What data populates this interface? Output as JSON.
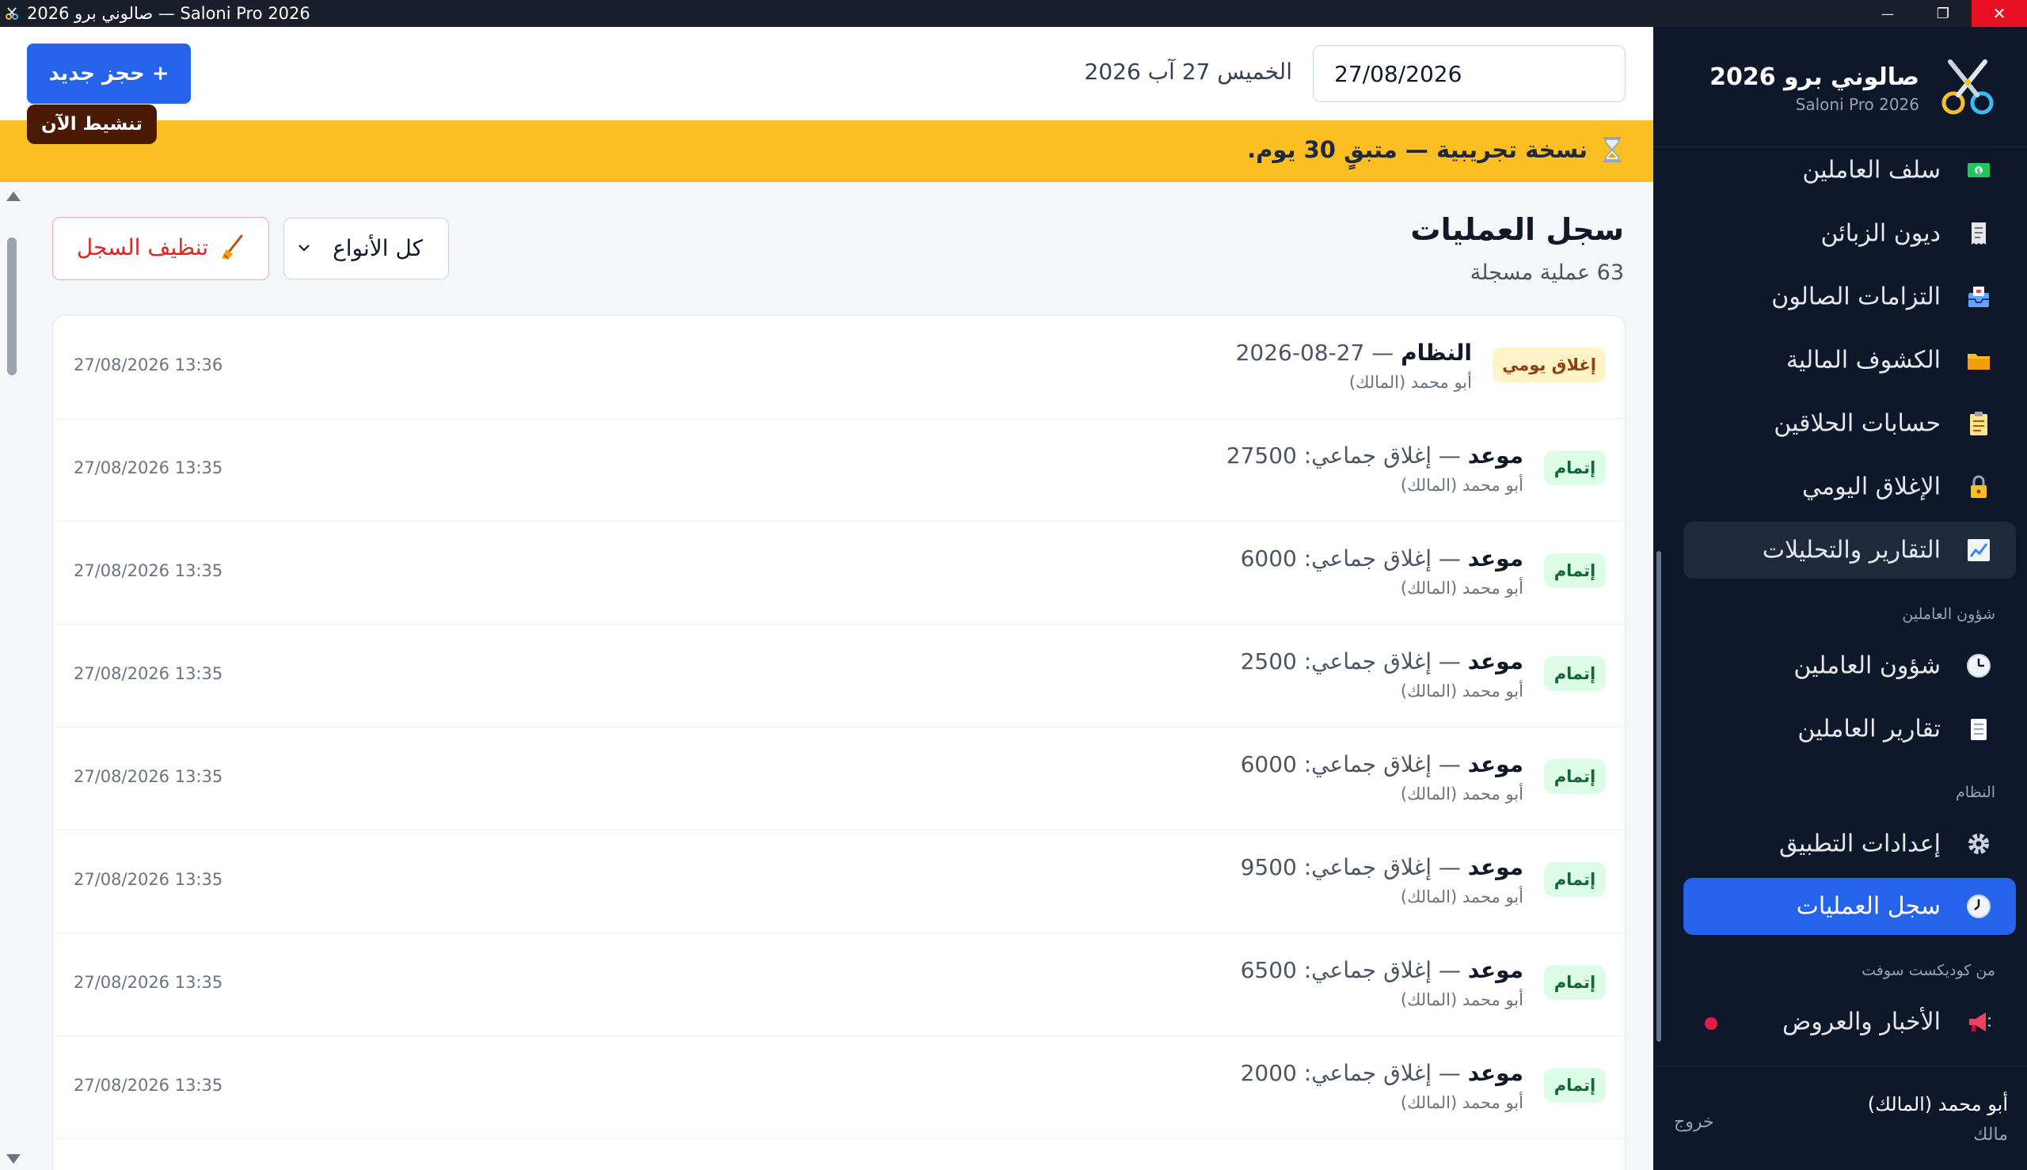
{
  "window": {
    "title": "صالوني برو 2026 — Saloni Pro 2026",
    "minimize": "—",
    "maximize": "❐",
    "close": "✕"
  },
  "brand": {
    "title": "صالوني برو 2026",
    "subtitle": "Saloni Pro 2026",
    "icon": "scissors-logo-icon"
  },
  "sidebar": {
    "items": [
      {
        "label": "سلف العاملين",
        "icon": "money-icon"
      },
      {
        "label": "ديون الزبائن",
        "icon": "receipt-icon"
      },
      {
        "label": "التزامات الصالون",
        "icon": "inbox-icon"
      },
      {
        "label": "الكشوف المالية",
        "icon": "folder-icon"
      },
      {
        "label": "حسابات الحلاقين",
        "icon": "clipboard-icon"
      },
      {
        "label": "الإغلاق اليومي",
        "icon": "lock-icon"
      },
      {
        "label": "التقارير والتحليلات",
        "icon": "chart-icon"
      }
    ],
    "section_staff": "شؤون العاملين",
    "staff_items": [
      {
        "label": "شؤون العاملين",
        "icon": "clock-icon"
      },
      {
        "label": "تقارير العاملين",
        "icon": "notepad-icon"
      }
    ],
    "section_system": "النظام",
    "system_items": [
      {
        "label": "إعدادات التطبيق",
        "icon": "gear-icon"
      },
      {
        "label": "سجل العمليات",
        "icon": "history-clock-icon"
      }
    ],
    "section_vendor": "من كوديكست سوفت",
    "vendor_items": [
      {
        "label": "الأخبار والعروض",
        "icon": "megaphone-icon"
      }
    ]
  },
  "user": {
    "name": "أبو محمد (المالك)",
    "role": "مالك",
    "logout": "خروج"
  },
  "topbar": {
    "new_booking": "+ حجز جديد",
    "date_label": "الخميس 27 آب 2026",
    "date_value": "27/08/2026"
  },
  "trial": {
    "text": "نسخة تجريبية — متبقٍ 30 يوم.",
    "activate": "تنشيط الآن",
    "icon": "hourglass-icon"
  },
  "page": {
    "title": "سجل العمليات",
    "count": "63 عملية مسجلة",
    "filter_value": "كل الأنواع",
    "clean_label": "تنظيف السجل",
    "clean_icon": "broom-icon"
  },
  "log": [
    {
      "badge": "إغلاق يومي",
      "kind": "close",
      "entity": "النظام",
      "detail": " — 27-08-2026",
      "user": "أبو محمد (المالك)",
      "time": "27/08/2026 13:36"
    },
    {
      "badge": "إتمام",
      "kind": "done",
      "entity": "موعد",
      "detail": " — إغلاق جماعي: 27500",
      "user": "أبو محمد (المالك)",
      "time": "27/08/2026 13:35"
    },
    {
      "badge": "إتمام",
      "kind": "done",
      "entity": "موعد",
      "detail": " — إغلاق جماعي: 6000",
      "user": "أبو محمد (المالك)",
      "time": "27/08/2026 13:35"
    },
    {
      "badge": "إتمام",
      "kind": "done",
      "entity": "موعد",
      "detail": " — إغلاق جماعي: 2500",
      "user": "أبو محمد (المالك)",
      "time": "27/08/2026 13:35"
    },
    {
      "badge": "إتمام",
      "kind": "done",
      "entity": "موعد",
      "detail": " — إغلاق جماعي: 6000",
      "user": "أبو محمد (المالك)",
      "time": "27/08/2026 13:35"
    },
    {
      "badge": "إتمام",
      "kind": "done",
      "entity": "موعد",
      "detail": " — إغلاق جماعي: 9500",
      "user": "أبو محمد (المالك)",
      "time": "27/08/2026 13:35"
    },
    {
      "badge": "إتمام",
      "kind": "done",
      "entity": "موعد",
      "detail": " — إغلاق جماعي: 6500",
      "user": "أبو محمد (المالك)",
      "time": "27/08/2026 13:35"
    },
    {
      "badge": "إتمام",
      "kind": "done",
      "entity": "موعد",
      "detail": " — إغلاق جماعي: 2000",
      "user": "أبو محمد (المالك)",
      "time": "27/08/2026 13:35"
    }
  ],
  "colors": {
    "accent": "#2563eb",
    "sidebar_bg": "#0f172a",
    "trial_bg": "#fbbf24",
    "danger": "#dc2626"
  }
}
